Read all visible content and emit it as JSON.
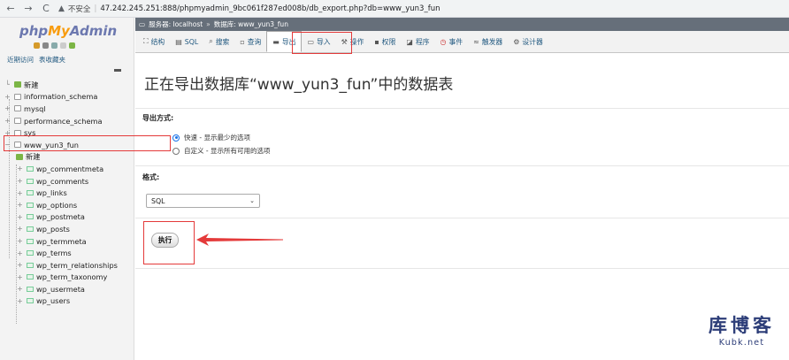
{
  "browser": {
    "back": "←",
    "forward": "→",
    "reload": "C",
    "warning_icon": "warning-icon",
    "security_label": "不安全",
    "url": "47.242.245.251:888/phpmyadmin_9bc061f287ed008b/db_export.php?db=www_yun3_fun"
  },
  "sidebar": {
    "logo_php": "php",
    "logo_my": "My",
    "logo_admin": "Admin",
    "recent": "近期访问",
    "favorites": "表收藏夹",
    "new_label": "新建",
    "databases": [
      "information_schema",
      "mysql",
      "performance_schema",
      "sys",
      "www_yun3_fun"
    ],
    "child_new": "新建",
    "tables": [
      "wp_commentmeta",
      "wp_comments",
      "wp_links",
      "wp_options",
      "wp_postmeta",
      "wp_posts",
      "wp_termmeta",
      "wp_terms",
      "wp_term_relationships",
      "wp_term_taxonomy",
      "wp_usermeta",
      "wp_users"
    ]
  },
  "breadcrumb": {
    "server": "服务器: localhost",
    "sep": "»",
    "database": "数据库: www_yun3_fun"
  },
  "tabs": [
    {
      "label": "结构",
      "icon": "structure-icon"
    },
    {
      "label": "SQL",
      "icon": "sql-icon"
    },
    {
      "label": "搜索",
      "icon": "search-icon"
    },
    {
      "label": "查询",
      "icon": "query-icon"
    },
    {
      "label": "导出",
      "icon": "export-icon"
    },
    {
      "label": "导入",
      "icon": "import-icon"
    },
    {
      "label": "操作",
      "icon": "wrench-icon"
    },
    {
      "label": "权限",
      "icon": "privileges-icon"
    },
    {
      "label": "程序",
      "icon": "routines-icon"
    },
    {
      "label": "事件",
      "icon": "clock-icon"
    },
    {
      "label": "触发器",
      "icon": "triggers-icon"
    },
    {
      "label": "设计器",
      "icon": "designer-icon"
    }
  ],
  "main": {
    "title": "正在导出数据库“www_yun3_fun”中的数据表",
    "export_method_label": "导出方式:",
    "option_quick": "快速 - 显示最少的选项",
    "option_custom": "自定义 - 显示所有可用的选项",
    "format_label": "格式:",
    "format_value": "SQL",
    "go_button": "执行"
  },
  "watermark": {
    "title": "库博客",
    "subtitle": "Kubk.net"
  },
  "colors": {
    "annotation": "#e43a3a",
    "link": "#235a81",
    "breadcrumb_bg": "#666f7a"
  }
}
